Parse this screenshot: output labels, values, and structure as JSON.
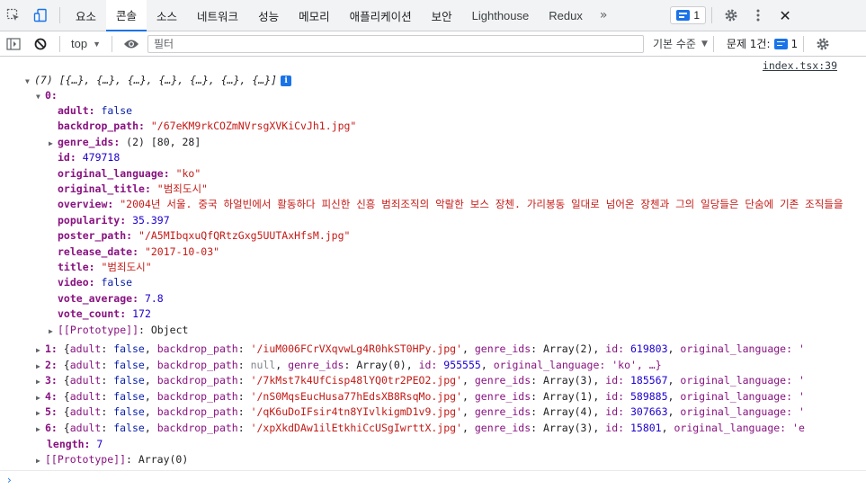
{
  "tabs": [
    {
      "label": "요소",
      "active": false
    },
    {
      "label": "콘솔",
      "active": true
    },
    {
      "label": "소스",
      "active": false
    },
    {
      "label": "네트워크",
      "active": false
    },
    {
      "label": "성능",
      "active": false
    },
    {
      "label": "메모리",
      "active": false
    },
    {
      "label": "애플리케이션",
      "active": false
    },
    {
      "label": "보안",
      "active": false
    },
    {
      "label": "Lighthouse",
      "active": false
    },
    {
      "label": "Redux",
      "active": false
    }
  ],
  "topbar": {
    "more": "»",
    "issue_count": "1",
    "settings_icon": "gear-icon",
    "menu_icon": "kebab-icon",
    "close": "✕"
  },
  "toolbar": {
    "context": "top",
    "filter_placeholder": "필터",
    "levels": "기본 수준",
    "issues_label": "문제 1건:",
    "issues_count": "1"
  },
  "console": {
    "source_link": "index.tsx:39",
    "summary": {
      "count": "(7)",
      "preview": "[{…}, {…}, {…}, {…}, {…}, {…}, {…}]",
      "info": "i"
    },
    "item0": {
      "index": "0:",
      "props": [
        {
          "key": "adult",
          "value": "false",
          "type": "bool",
          "expandable": false
        },
        {
          "key": "backdrop_path",
          "value": "\"/67eKM9rkCOZmNVrsgXVKiCvJh1.jpg\"",
          "type": "str",
          "expandable": false
        },
        {
          "key": "genre_ids",
          "value": "(2) [80, 28]",
          "type": "plain",
          "expandable": true
        },
        {
          "key": "id",
          "value": "479718",
          "type": "num",
          "expandable": false
        },
        {
          "key": "original_language",
          "value": "\"ko\"",
          "type": "str",
          "expandable": false
        },
        {
          "key": "original_title",
          "value": "\"범죄도시\"",
          "type": "str",
          "expandable": false
        },
        {
          "key": "overview",
          "value": "\"2004년 서울. 중국 하얼빈에서 활동하다 피신한 신흥 범죄조직의 악랄한 보스 장첸. 가리봉동 일대로 넘어온 장첸과 그의 일당들은 단숨에 기존 조직들을",
          "type": "str",
          "expandable": false
        },
        {
          "key": "popularity",
          "value": "35.397",
          "type": "num",
          "expandable": false
        },
        {
          "key": "poster_path",
          "value": "\"/A5MIbqxuQfQRtzGxg5UUTAxHfsM.jpg\"",
          "type": "str",
          "expandable": false
        },
        {
          "key": "release_date",
          "value": "\"2017-10-03\"",
          "type": "str",
          "expandable": false
        },
        {
          "key": "title",
          "value": "\"범죄도시\"",
          "type": "str",
          "expandable": false
        },
        {
          "key": "video",
          "value": "false",
          "type": "bool",
          "expandable": false
        },
        {
          "key": "vote_average",
          "value": "7.8",
          "type": "num",
          "expandable": false
        },
        {
          "key": "vote_count",
          "value": "172",
          "type": "num",
          "expandable": false
        },
        {
          "key": "[[Prototype]]",
          "value": "Object",
          "type": "plain",
          "expandable": true
        }
      ]
    },
    "items": [
      {
        "index": "1:",
        "backdrop": "'/iuM006FCrVXqvwLg4R0hkST0HPy.jpg'",
        "backdrop_type": "str",
        "genre": "Array(2)",
        "id_key": "id:",
        "id": "619803",
        "tail": "original_language: '"
      },
      {
        "index": "2:",
        "backdrop": "null",
        "backdrop_type": "null",
        "genre": "Array(0)",
        "id_key": "id:",
        "id": "955555",
        "tail": "original_language: 'ko', …}"
      },
      {
        "index": "3:",
        "backdrop": "'/7kMst7k4UfCisp48lYQ0tr2PEO2.jpg'",
        "backdrop_type": "str",
        "genre": "Array(3)",
        "id_key": "id:",
        "id": "185567",
        "tail": "original_language: '"
      },
      {
        "index": "4:",
        "backdrop": "'/nS0MqsEucHusa77hEdsXB8RsqMo.jpg'",
        "backdrop_type": "str",
        "genre": "Array(1)",
        "id_key": "id:",
        "id": "589885",
        "tail": "original_language: '"
      },
      {
        "index": "5:",
        "backdrop": "'/qK6uDoIFsir4tn8YIvlkigmD1v9.jpg'",
        "backdrop_type": "str",
        "genre": "Array(4)",
        "id_key": "id:",
        "id": "307663",
        "tail": "original_language: '"
      },
      {
        "index": "6:",
        "backdrop": "'/xpXkdDAw1ilEtkhiCcUSgIwrttX.jpg'",
        "backdrop_type": "str",
        "genre": "Array(3)",
        "id_key": "id:",
        "id": "15801",
        "tail": "original_language: 'e"
      }
    ],
    "length": {
      "key": "length",
      "value": "7"
    },
    "array_proto": {
      "key": "[[Prototype]]",
      "value": "Array(0)"
    },
    "prompt": "›"
  }
}
